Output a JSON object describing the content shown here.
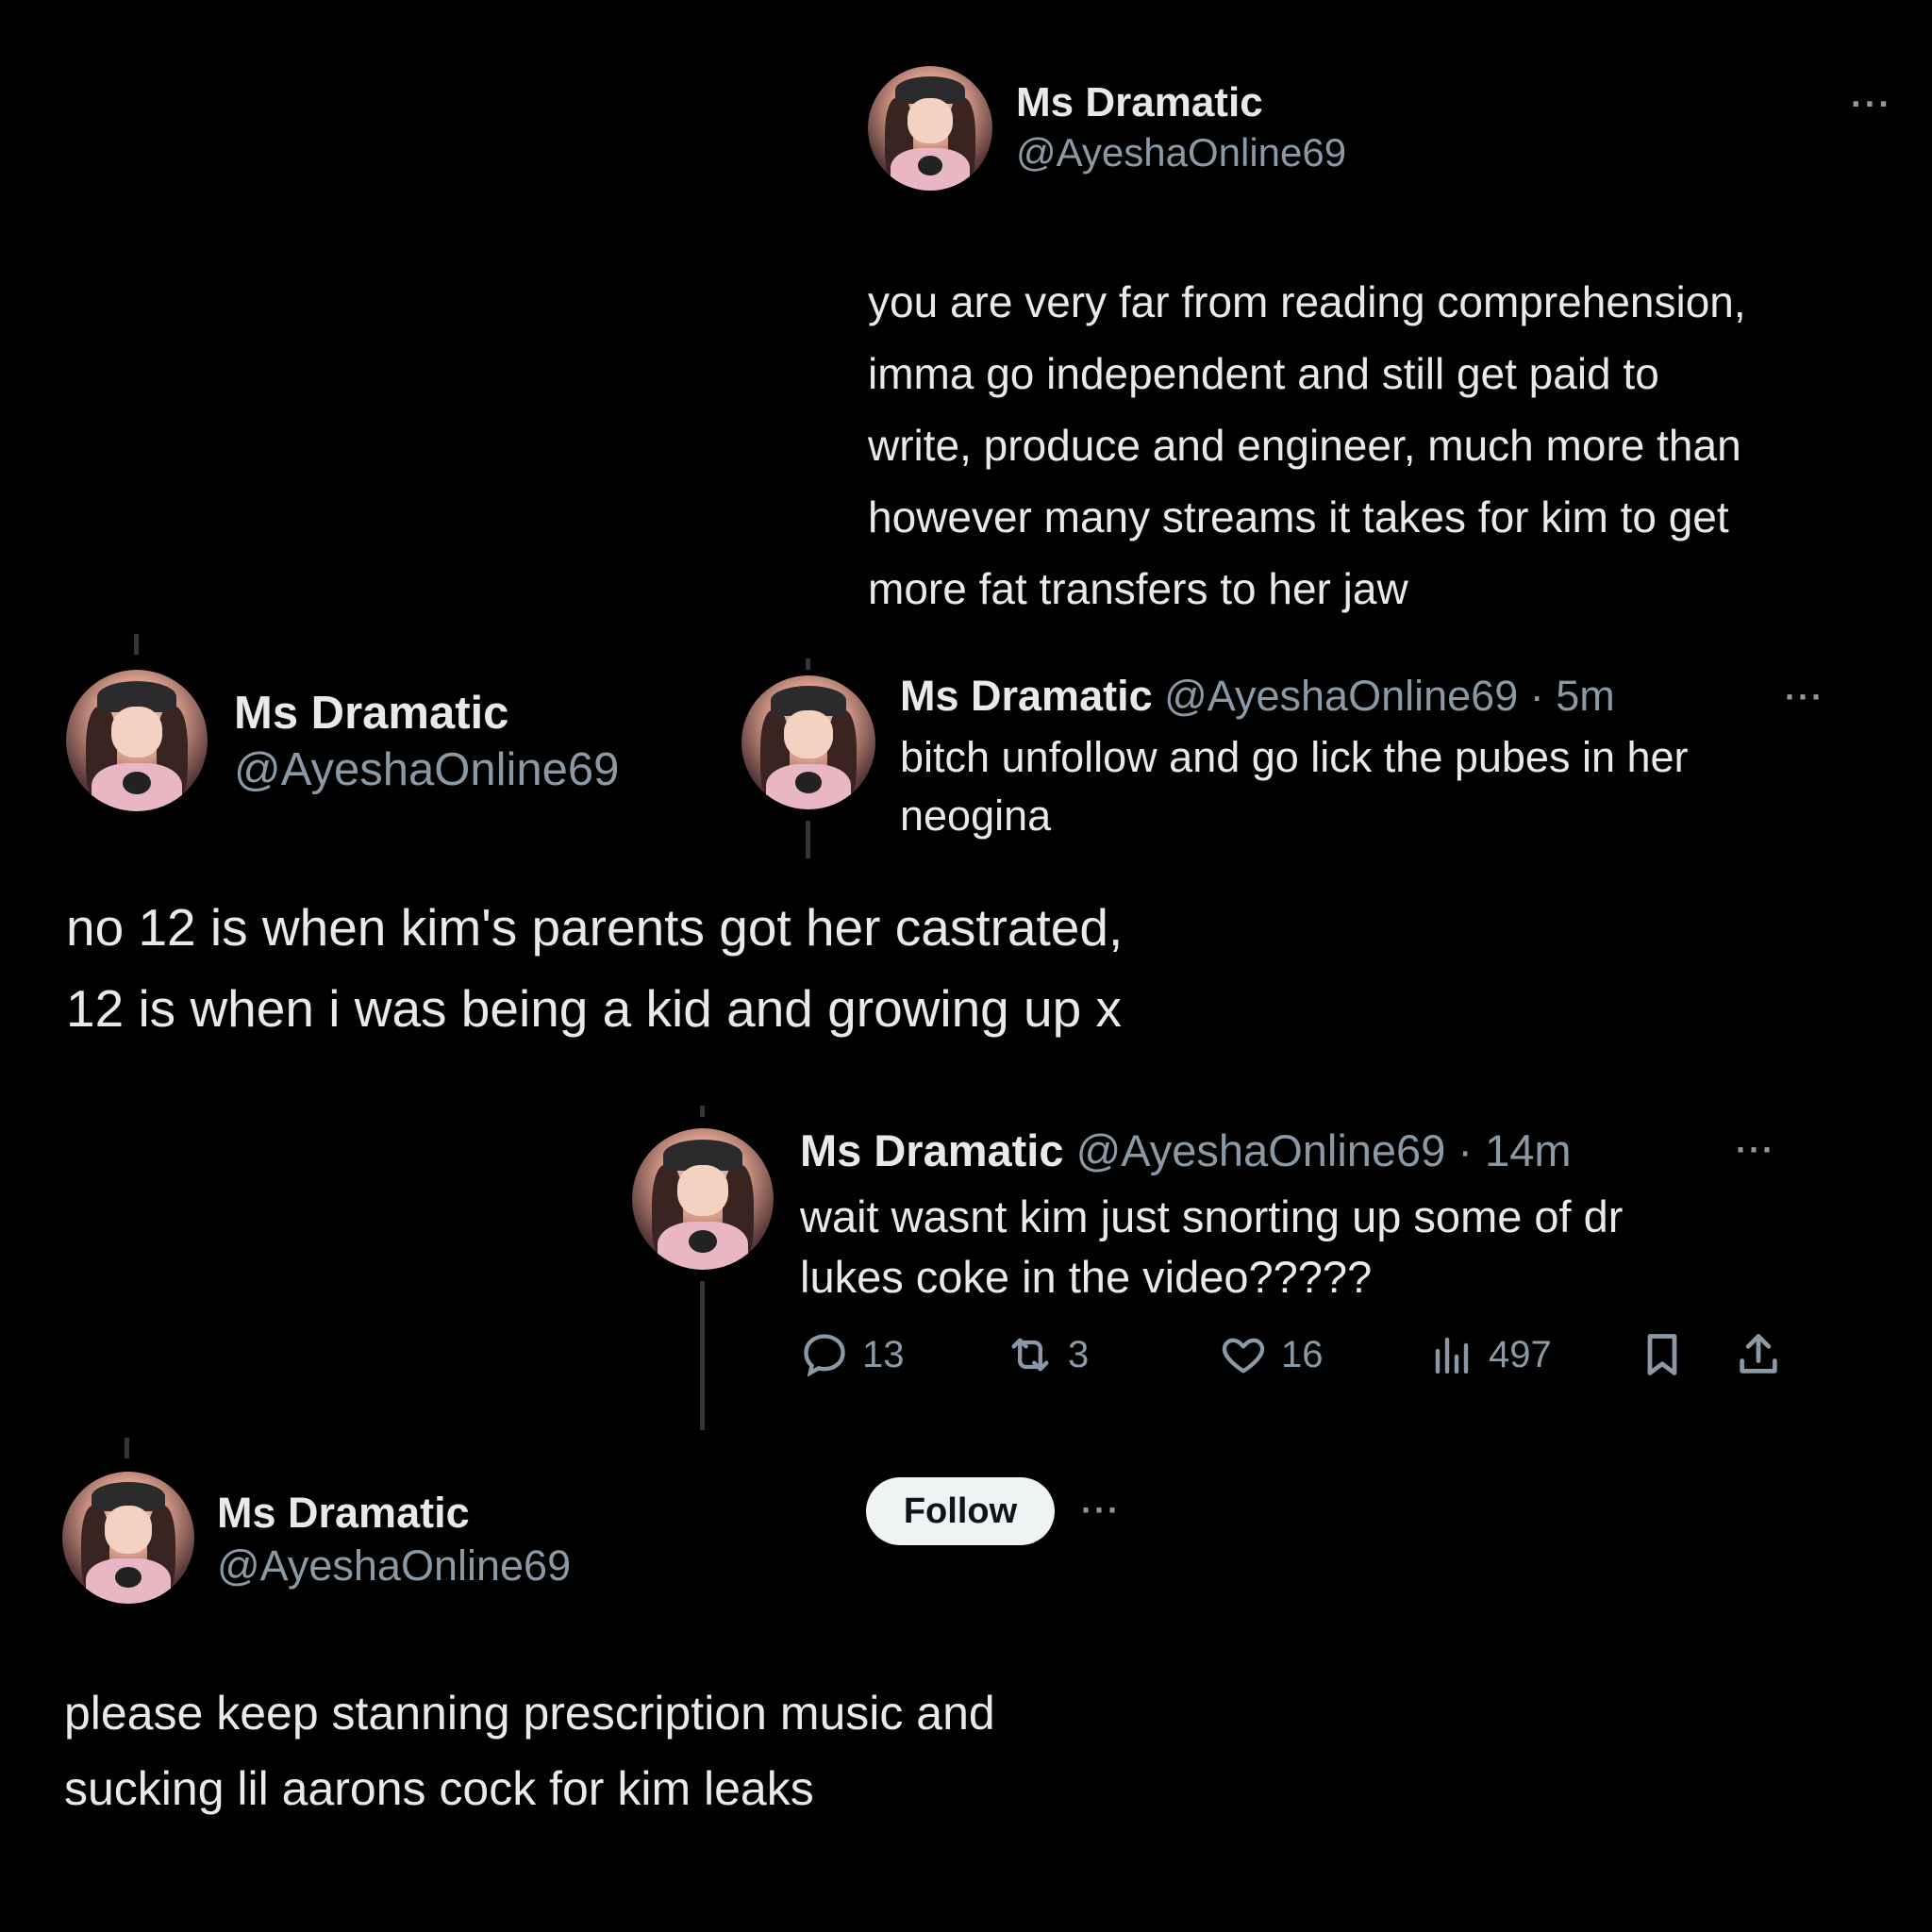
{
  "tweet1": {
    "name": "Ms Dramatic",
    "handle": "@AyeshaOnline69",
    "more": "···",
    "lines": [
      "you are very far from reading comprehension,",
      "imma go independent and still get paid to",
      "write, produce and engineer, much more than",
      "however many streams it takes for kim to get",
      "more fat transfers to her jaw"
    ]
  },
  "tweet2": {
    "name": "Ms Dramatic",
    "handle": "@AyeshaOnline69",
    "lines": [
      "no 12 is when kim's parents got her castrated,",
      "12 is when i was being a kid and growing up x"
    ]
  },
  "tweet3": {
    "name": "Ms Dramatic",
    "meta": "@AyeshaOnline69 · 5m",
    "more": "···",
    "lines": [
      "bitch unfollow and go lick the pubes in her",
      "neogina"
    ]
  },
  "tweet4": {
    "name": "Ms Dramatic",
    "meta": "@AyeshaOnline69 · 14m",
    "more": "···",
    "lines": [
      "wait wasnt kim just snorting up some of dr",
      "lukes coke in the video?????"
    ],
    "actions": {
      "replies": "13",
      "reposts": "3",
      "likes": "16",
      "views": "497"
    }
  },
  "tweet5": {
    "name": "Ms Dramatic",
    "handle": "@AyeshaOnline69",
    "follow_label": "Follow",
    "more": "···",
    "lines": [
      "please keep stanning prescription music and",
      "sucking lil aarons cock for kim leaks"
    ]
  }
}
